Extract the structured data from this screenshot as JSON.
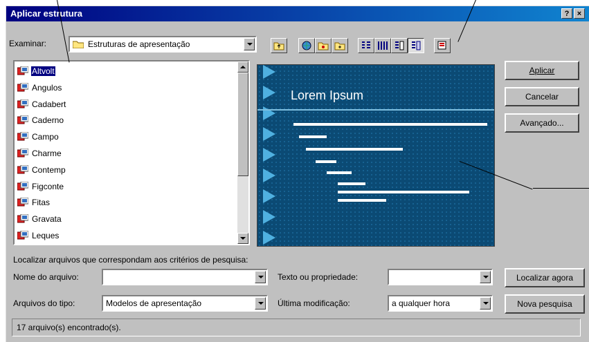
{
  "window": {
    "title": "Aplicar estrutura",
    "help": "?",
    "close": "×"
  },
  "look_in": {
    "label": "Examinar:",
    "value": "Estruturas de apresentação"
  },
  "files": [
    {
      "name": "Altvolt",
      "selected": true
    },
    {
      "name": "Angulos"
    },
    {
      "name": "Cadabert"
    },
    {
      "name": "Caderno"
    },
    {
      "name": "Campo"
    },
    {
      "name": "Charme"
    },
    {
      "name": "Contemp"
    },
    {
      "name": "Figconte"
    },
    {
      "name": "Fitas"
    },
    {
      "name": "Gravata"
    },
    {
      "name": "Leques"
    }
  ],
  "preview": {
    "title": "Lorem Ipsum"
  },
  "buttons": {
    "apply": "Aplicar",
    "cancel": "Cancelar",
    "advanced": "Avançado...",
    "find_now": "Localizar agora",
    "new_search": "Nova pesquisa"
  },
  "search": {
    "heading": "Localizar arquivos que correspondam aos critérios de pesquisa:",
    "file_name_label": "Nome do arquivo:",
    "file_name_value": "",
    "text_label": "Texto ou propriedade:",
    "text_value": "",
    "type_label": "Arquivos do tipo:",
    "type_value": "Modelos de apresentação",
    "modified_label": "Última modificação:",
    "modified_value": "a qualquer hora"
  },
  "status": "17 arquivo(s) encontrado(s).",
  "colors": {
    "title_bar": "#000080",
    "preview_bg": "#0b4a74",
    "selection": "#000080"
  }
}
